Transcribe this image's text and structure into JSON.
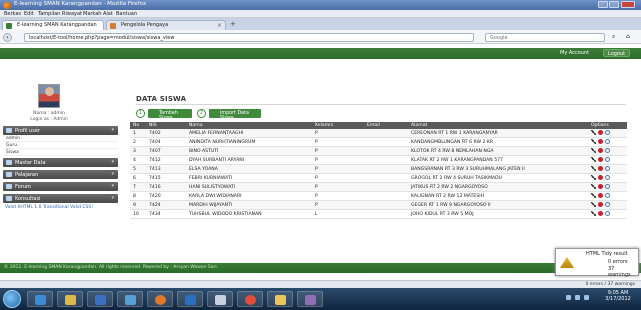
{
  "window": {
    "title": "E-learning SMAN Karangpandan - Mozilla Firefox"
  },
  "menu": [
    "Berkas",
    "Edit",
    "Tampilan",
    "Riwayat",
    "Markah",
    "Alat",
    "Bantuan"
  ],
  "tabs": [
    {
      "label": "E-learning SMAN Karangpandan",
      "active": true
    },
    {
      "label": "Pengelola Pengaya",
      "active": false
    }
  ],
  "urlbar": {
    "url": "localhost/E-tool/home.php?page=modul/siswa/siswa_view",
    "search_placeholder": "Google"
  },
  "topband": {
    "account": "My Account",
    "logout": "Logout"
  },
  "sidebar": {
    "user_name": "Nama : admin",
    "user_level": "Login as : Admin",
    "sections": [
      {
        "label": "Profil user"
      },
      {
        "label": "Master Data"
      },
      {
        "label": "Pelajaran"
      },
      {
        "label": "Forum"
      },
      {
        "label": "Konsultasi"
      }
    ],
    "profile_items": [
      "admin",
      "Guru",
      "Siswa"
    ],
    "valid_text": "Valid XHTML 1.0 Transitional Valid CSS!"
  },
  "content": {
    "heading": "DATA SISWA",
    "buttons": [
      {
        "num": "1",
        "label": "Tambah Siswa"
      },
      {
        "num": "2",
        "label": "Import Data Siswa"
      }
    ],
    "columns": [
      "No",
      "NIS",
      "Nama",
      "Kelamin",
      "Email",
      "Alamat",
      "Options"
    ],
    "rows": [
      {
        "no": "1",
        "nis": "7402",
        "nama": "AMELIA FERNANTAAGHI",
        "kelamin": "P",
        "email": "",
        "alamat": "CEREONAN RT 1 RW 1 KARANGANYAR"
      },
      {
        "no": "2",
        "nis": "7404",
        "nama": "ANINDITA NURHTIANINGRUM",
        "kelamin": "P",
        "email": "",
        "alamat": "KANDANGMBLUNGAN RT 6 RW 2 KR"
      },
      {
        "no": "3",
        "nis": "7407",
        "nama": "BINO ASTUTI",
        "kelamin": "P",
        "email": "",
        "alamat": "KLOTOK RT 4 RW 8 NEMLAHAN NGA"
      },
      {
        "no": "4",
        "nis": "7412",
        "nama": "DYAH SURBANTI ARYANI",
        "kelamin": "P",
        "email": "",
        "alamat": "KLATAK RT 2 RW 1 KARANGPANDAN 577"
      },
      {
        "no": "5",
        "nis": "7413",
        "nama": "ELSA YOANA",
        "kelamin": "P",
        "email": "",
        "alamat": "BANGSRANAN RT 3 RW 3 SURUHMALANG JATEN II"
      },
      {
        "no": "6",
        "nis": "7415",
        "nama": "FEBRI KURNIAWATI",
        "kelamin": "P",
        "email": "",
        "alamat": "GROGOL RT 2 RW 4 SURUH TASIKMADU"
      },
      {
        "no": "7",
        "nis": "7416",
        "nama": "HANI SULISTYOWATI",
        "kelamin": "P",
        "email": "",
        "alamat": "JATIKUS RT 2 RW 2 NGARGOYOSO"
      },
      {
        "no": "8",
        "nis": "7420",
        "nama": "KARLA DWI WIDIANARI",
        "kelamin": "P",
        "email": "",
        "alamat": "KALIGNAN RT 2 RW 12 MATESIH"
      },
      {
        "no": "9",
        "nis": "7424",
        "nama": "MARDIH WIJAYANTI",
        "kelamin": "P",
        "email": "",
        "alamat": "GEGER RT 1 RW 9 NGARGOYOSO II"
      },
      {
        "no": "10",
        "nis": "7434",
        "nama": "TUHSBUL WIDODO KRISTIANAN",
        "kelamin": "L",
        "email": "",
        "alamat": "JOHO KIDUL RT 3 RW 5 MOJ"
      }
    ],
    "pager": [
      "<",
      "1",
      "2",
      ">"
    ],
    "totals": "Total Siswa : 20 Siswa"
  },
  "footer": {
    "text": "© 2011. E-learning SMAN Karangpandan. All rights reserved. Powered by : Arsyan Wawan Sari."
  },
  "tidy": {
    "title": "HTML Tidy result",
    "errors": "0 errors",
    "warnings": "37 warnings"
  },
  "statusbar": {
    "text": "0 errors / 37 warnings"
  },
  "clock": {
    "time": "9:05 AM",
    "date": "3/17/2012"
  }
}
